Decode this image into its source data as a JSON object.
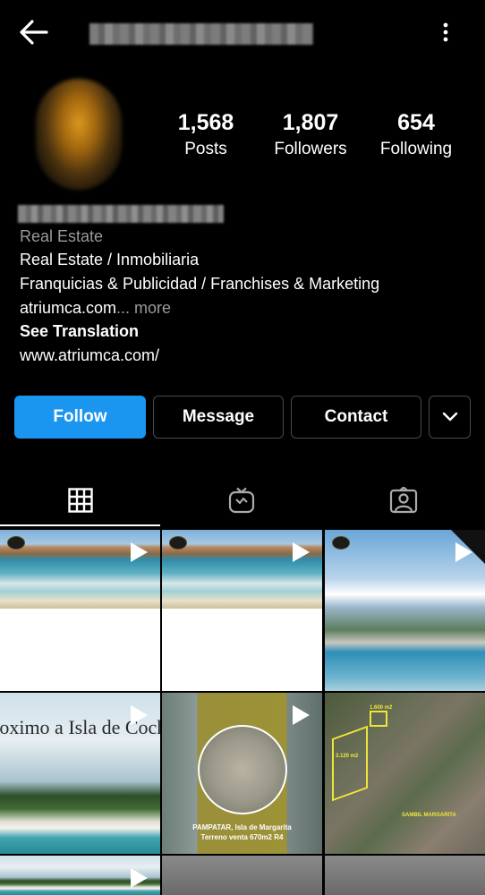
{
  "profile": {
    "stats": {
      "posts_count": "1,568",
      "posts_label": "Posts",
      "followers_count": "1,807",
      "followers_label": "Followers",
      "following_count": "654",
      "following_label": "Following"
    },
    "category": "Real Estate",
    "bio_line_1": "Real Estate / Inmobiliaria",
    "bio_line_2": "Franquicias & Publicidad / Franchises & Marketing",
    "bio_line_3": "atriumca.com",
    "bio_more": "... more",
    "see_translation": "See Translation",
    "website": "www.atriumca.com/"
  },
  "actions": {
    "follow": "Follow",
    "message": "Message",
    "contact": "Contact"
  },
  "tabs": [
    {
      "icon": "grid-icon",
      "active": true
    },
    {
      "icon": "igtv-icon",
      "active": false
    },
    {
      "icon": "tagged-icon",
      "active": false
    }
  ],
  "grid": {
    "island_caption": "roximo a Isla de Coch",
    "pampatar_line_1": "PAMPATAR, Isla de Margarita",
    "pampatar_line_2": "Terreno venta 670m2 R4",
    "aerial_area_1": "3.120 m2",
    "aerial_area_2": "1.600 m2",
    "aerial_place": "SAMBIL MARGARITA"
  },
  "colors": {
    "background": "#000000",
    "follow_button": "#1a96f0",
    "secondary_text": "#9a9a9a",
    "button_border": "#4a4a4a"
  }
}
